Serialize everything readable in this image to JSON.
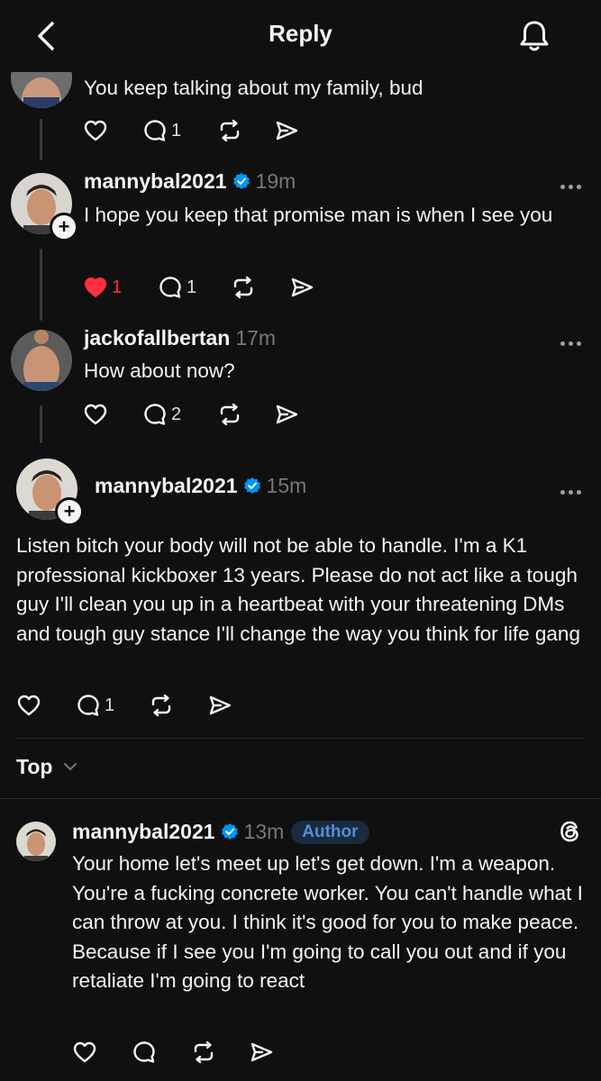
{
  "header": {
    "title": "Reply",
    "back_icon": "chevron-left-icon",
    "bell_icon": "bell-icon"
  },
  "posts": [
    {
      "username": "",
      "time": "",
      "text": "You keep talking about my family, bud",
      "likes": "",
      "replies": "1"
    },
    {
      "username": "mannybal2021",
      "time": "19m",
      "text": "I hope you keep that promise man is when I see you",
      "likes": "1",
      "liked": true,
      "replies": "1"
    },
    {
      "username": "jackofallbertan",
      "time": "17m",
      "text": "How about now?",
      "replies": "2"
    },
    {
      "username": "mannybal2021",
      "time": "15m",
      "text": "Listen bitch your body will not be able to handle. I'm a K1 professional kickboxer 13 years. Please do not act like a tough guy I'll clean you up in a heartbeat with your threatening DMs and tough guy stance I'll change the way you think for life gang",
      "replies": "1"
    }
  ],
  "sort": {
    "label": "Top"
  },
  "reply": {
    "username": "mannybal2021",
    "time": "13m",
    "badge": "Author",
    "text": "Your home let's meet up let's get down. I'm a weapon. You're a fucking concrete worker. You can't handle what I can throw at you. I think it's good for you to make peace. Because if I see you I'm going to call you out and if you retaliate I'm going to react"
  },
  "colors": {
    "background": "#101010",
    "verified": "#0095f6",
    "like": "#ff3040",
    "author_badge": "#4f8fd8"
  }
}
